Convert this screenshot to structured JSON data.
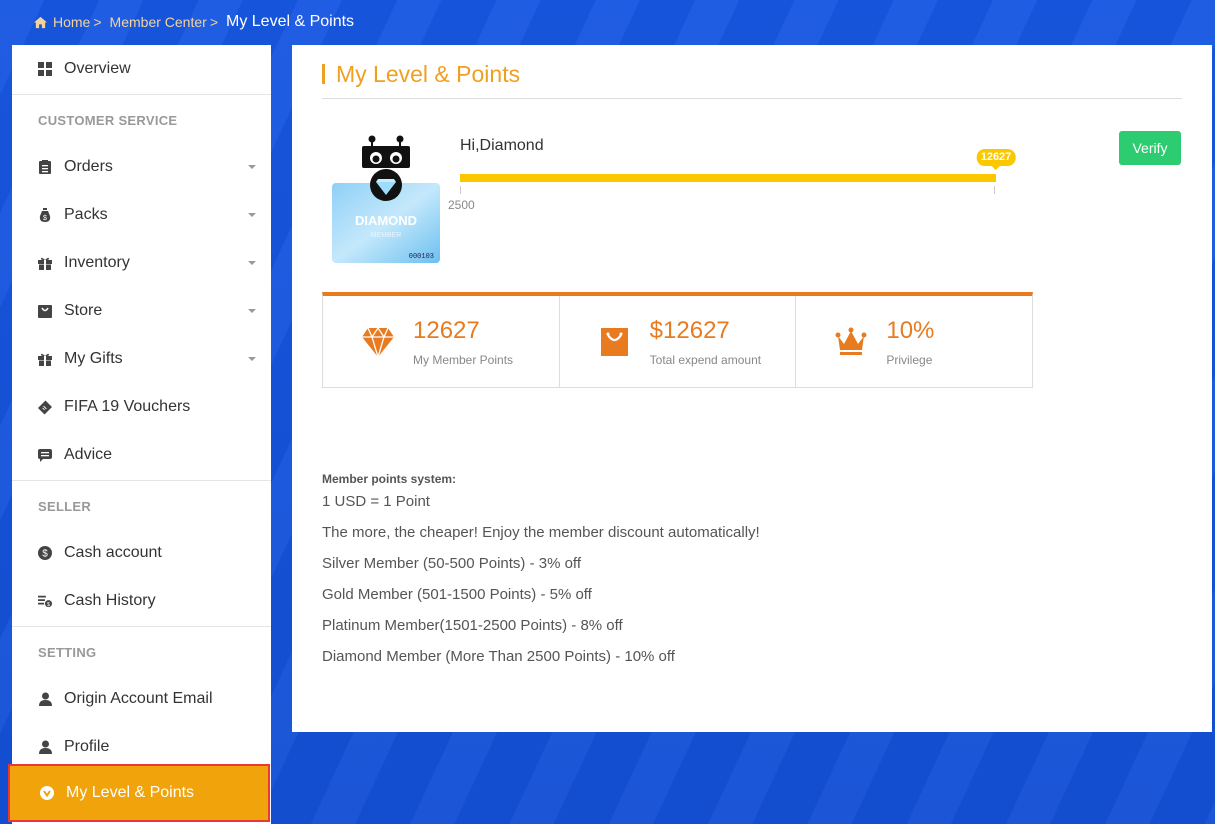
{
  "breadcrumb": {
    "items": [
      "Home",
      "Member Center"
    ],
    "separator": ">",
    "current": "My Level & Points"
  },
  "sidebar": {
    "overview": "Overview",
    "sections": {
      "customer_service": "CUSTOMER SERVICE",
      "seller": "SELLER",
      "setting": "SETTING"
    },
    "items": [
      {
        "label": "Orders",
        "icon": "clipboard-icon",
        "expandable": true
      },
      {
        "label": "Packs",
        "icon": "money-bag-icon",
        "expandable": true
      },
      {
        "label": "Inventory",
        "icon": "gift-icon",
        "expandable": true
      },
      {
        "label": "Store",
        "icon": "shopping-bag-icon",
        "expandable": true
      },
      {
        "label": "My Gifts",
        "icon": "gift-icon",
        "expandable": true
      },
      {
        "label": "FIFA 19 Vouchers",
        "icon": "ticket-icon",
        "expandable": false
      },
      {
        "label": "Advice",
        "icon": "comment-icon",
        "expandable": false
      },
      {
        "label": "Cash account",
        "icon": "dollar-circle-icon",
        "expandable": false
      },
      {
        "label": "Cash History",
        "icon": "coin-stack-icon",
        "expandable": false
      },
      {
        "label": "Origin Account Email",
        "icon": "user-icon",
        "expandable": false
      },
      {
        "label": "Profile",
        "icon": "user-icon",
        "expandable": false
      },
      {
        "label": "My Level & Points",
        "icon": "v-badge-icon",
        "expandable": false,
        "active": true
      }
    ]
  },
  "main": {
    "title": "My Level & Points",
    "greeting": "Hi,Diamond",
    "card": {
      "tier": "DIAMOND",
      "sub": "MEMBER",
      "number": "000103"
    },
    "progress": {
      "start_label": "2500",
      "current_value": "12627",
      "fill_fraction": 1.0
    },
    "verify_label": "Verify",
    "stats": [
      {
        "value": "12627",
        "label": "My Member Points",
        "icon": "diamond-icon"
      },
      {
        "value": "$12627",
        "label": "Total expend amount",
        "icon": "shopping-bag-icon"
      },
      {
        "value": "10%",
        "label": "Privilege",
        "icon": "crown-icon"
      }
    ],
    "rules": {
      "heading": "Member points system:",
      "lines": [
        "1 USD = 1 Point",
        "The more, the cheaper! Enjoy the member discount automatically!",
        "Silver Member (50-500 Points) - 3% off",
        "Gold Member (501-1500 Points) - 5% off",
        "Platinum Member(1501-2500 Points) - 8% off",
        "Diamond Member (More Than 2500 Points) - 10% off"
      ]
    }
  },
  "colors": {
    "accent_orange": "#f0a020",
    "active_nav": "#f0a30a",
    "stat_orange": "#e87a20",
    "progress_yellow": "#fbc800",
    "verify_green": "#2ecc71",
    "background_blue": "#1650d8"
  }
}
